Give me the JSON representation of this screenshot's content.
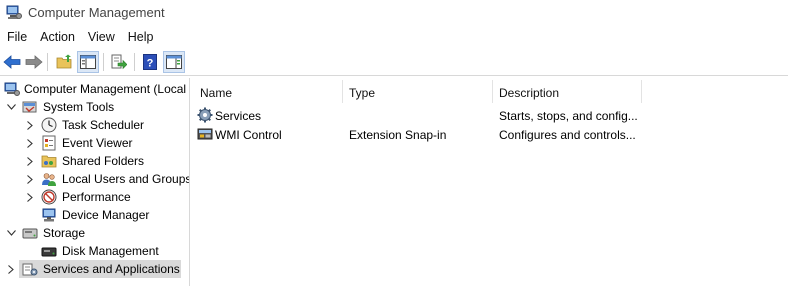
{
  "window": {
    "title": "Computer Management"
  },
  "menu": [
    "File",
    "Action",
    "View",
    "Help"
  ],
  "toolbar": {
    "buttons": [
      "back-icon",
      "forward-icon",
      "up-folder-icon",
      "show-hide-tree-icon",
      "export-list-icon",
      "help-icon",
      "show-hide-action-pane-icon"
    ]
  },
  "tree": {
    "items": [
      {
        "label": "Computer Management (Local",
        "icon": "computer-management-icon"
      },
      {
        "label": "System Tools",
        "icon": "system-tools-icon",
        "state": "expanded"
      },
      {
        "label": "Task Scheduler",
        "icon": "task-scheduler-icon",
        "state": "collapsed"
      },
      {
        "label": "Event Viewer",
        "icon": "event-viewer-icon",
        "state": "collapsed"
      },
      {
        "label": "Shared Folders",
        "icon": "shared-folders-icon",
        "state": "collapsed"
      },
      {
        "label": "Local Users and Groups",
        "icon": "users-groups-icon",
        "state": "collapsed"
      },
      {
        "label": "Performance",
        "icon": "performance-icon",
        "state": "collapsed"
      },
      {
        "label": "Device Manager",
        "icon": "device-manager-icon"
      },
      {
        "label": "Storage",
        "icon": "storage-icon",
        "state": "expanded"
      },
      {
        "label": "Disk Management",
        "icon": "disk-management-icon"
      },
      {
        "label": "Services and Applications",
        "icon": "services-applications-icon",
        "state": "collapsed",
        "selected": true
      }
    ]
  },
  "list": {
    "columns": [
      "Name",
      "Type",
      "Description"
    ],
    "rows": [
      {
        "name": "Services",
        "type": "",
        "description": "Starts, stops, and config...",
        "icon": "services-gear-icon"
      },
      {
        "name": "WMI Control",
        "type": "Extension Snap-in",
        "description": "Configures and controls...",
        "icon": "wmi-control-icon"
      }
    ]
  },
  "colors": {
    "selection": "#d9d9d9",
    "toolbar_active": "#dbe7f6",
    "nav_arrow": "#2f6fcf"
  }
}
